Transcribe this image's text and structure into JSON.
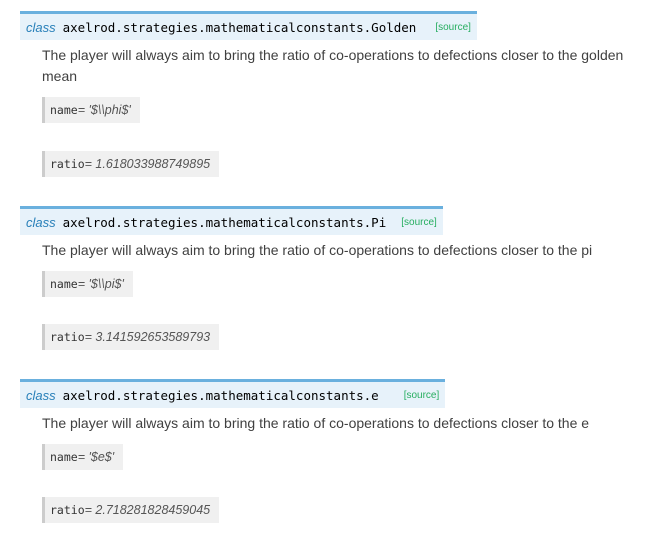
{
  "entries": [
    {
      "keyword": "class",
      "name": "axelrod.strategies.mathematicalconstants.Golden",
      "source_link": "[source]",
      "description": "The player will always aim to bring the ratio of co-operations to defections closer to the golden mean",
      "name_attr_label": "name",
      "name_attr_value": " = '$\\\\phi$'",
      "ratio_attr_label": "ratio",
      "ratio_attr_value": " = 1.618033988749895"
    },
    {
      "keyword": "class",
      "name": "axelrod.strategies.mathematicalconstants.Pi",
      "source_link": "[source]",
      "description": "The player will always aim to bring the ratio of co-operations to defections closer to the pi",
      "name_attr_label": "name",
      "name_attr_value": " = '$\\\\pi$'",
      "ratio_attr_label": "ratio",
      "ratio_attr_value": " = 3.141592653589793"
    },
    {
      "keyword": "class",
      "name": "axelrod.strategies.mathematicalconstants.e",
      "source_link": "[source]",
      "description": "The player will always aim to bring the ratio of co-operations to defections closer to the e",
      "name_attr_label": "name",
      "name_attr_value": " = '$e$'",
      "ratio_attr_label": "ratio",
      "ratio_attr_value": " = 2.718281828459045"
    }
  ],
  "colors": {
    "signature_bg": "#e7f2fa",
    "signature_border": "#6ab0de",
    "keyword": "#2980b9",
    "source_link": "#27ae60",
    "attr_bg": "#f0f0f0",
    "attr_border": "#cccccc"
  }
}
